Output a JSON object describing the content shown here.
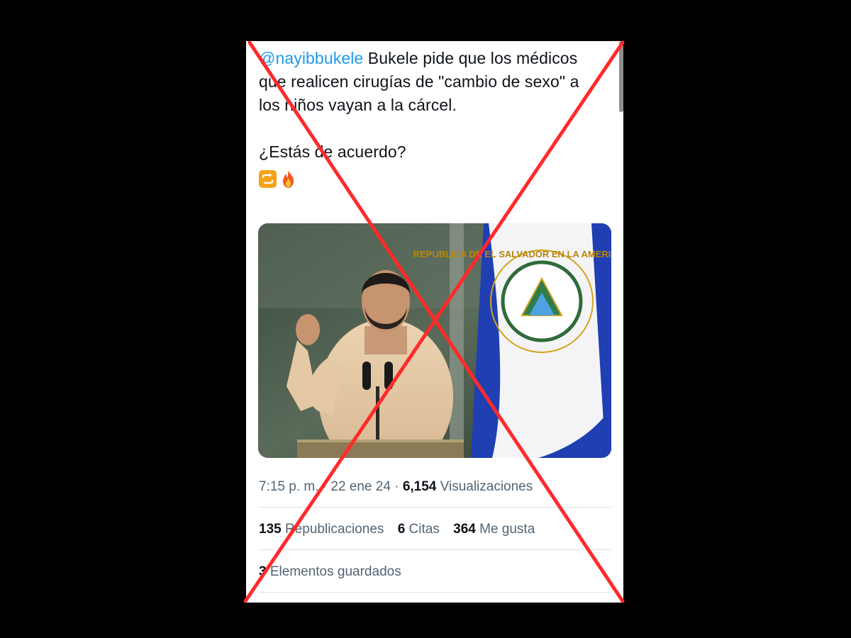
{
  "tweet": {
    "mention": "@nayibbukele",
    "line1_rest": " Bukele pide que los médicos",
    "line2": "que realicen cirugías de \"cambio de sexo\" a",
    "line3": "los niños vayan a la cárcel.",
    "question": "¿Estás de acuerdo?",
    "emojis": [
      "repeat-emoji",
      "fire-emoji"
    ]
  },
  "media": {
    "flag_text": "REPUBLICA DE EL SALVADOR EN LA AMERICA CENTRAL"
  },
  "meta": {
    "time": "7:15 p. m.",
    "separator1": " · ",
    "date": "22 ene 24",
    "separator2": " · ",
    "views_count": "6,154",
    "views_label": " Visualizaciones"
  },
  "stats": {
    "reposts_count": "135",
    "reposts_label": " Republicaciones",
    "quotes_count": "6",
    "quotes_label": " Citas",
    "likes_count": "364",
    "likes_label": " Me gusta"
  },
  "saved": {
    "count": "3",
    "label": " Elementos guardados"
  },
  "colors": {
    "background": "#000000",
    "panel": "#ffffff",
    "mention": "#1d9bf0",
    "text": "#0f1419",
    "secondary_text": "#536471",
    "cross": "#ff2a2a",
    "flag_blue": "#1f3fb3"
  }
}
